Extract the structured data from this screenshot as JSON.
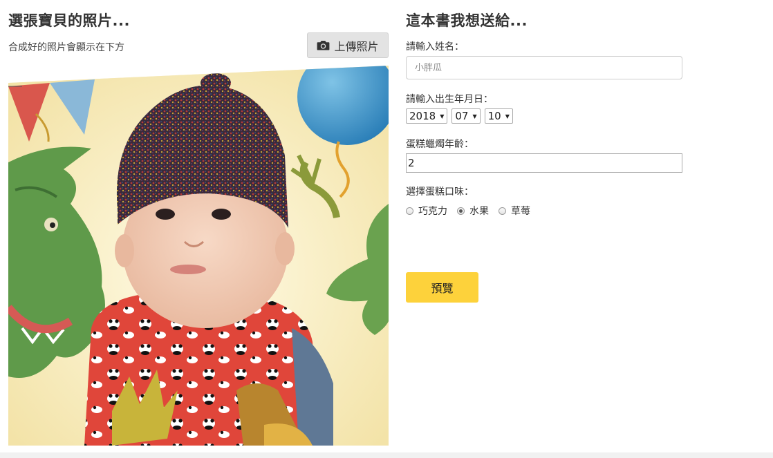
{
  "left": {
    "title": "選張寶貝的照片...",
    "subtitle": "合成好的照片會顯示在下方",
    "upload_label": "上傳照片",
    "upload_icon": "camera-icon"
  },
  "right": {
    "title": "這本書我想送給...",
    "name_label": "請輸入姓名：",
    "name_placeholder": "小胖瓜",
    "birth_label": "請輸入出生年月日：",
    "birth_year": "2018",
    "birth_month": "07",
    "birth_day": "10",
    "age_label": "蛋糕蠟燭年齡：",
    "age_value": "2",
    "flavor_label": "選擇蛋糕口味：",
    "flavors": [
      {
        "label": "巧克力",
        "checked": false
      },
      {
        "label": "水果",
        "checked": true
      },
      {
        "label": "草莓",
        "checked": false
      }
    ],
    "preview_label": "預覽"
  },
  "colors": {
    "accent_yellow": "#fdd23b",
    "upload_button_bg": "#e3e3e3",
    "bib_red": "#e0463a",
    "hat_knit": "#3a2a3a",
    "crocodile_green": "#5f9a4a"
  }
}
